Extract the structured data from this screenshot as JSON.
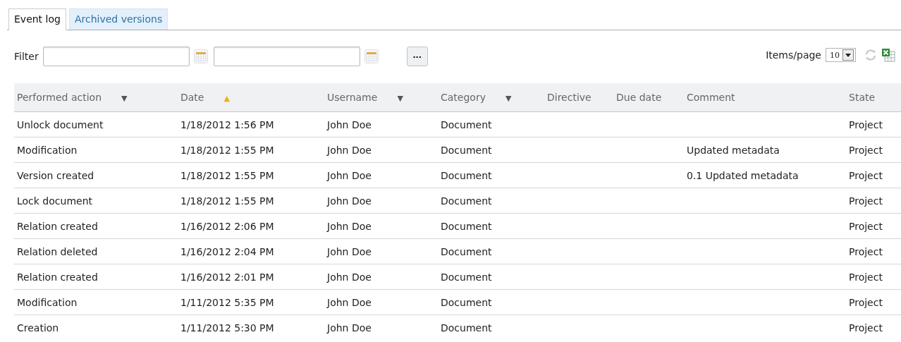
{
  "tabs": [
    {
      "label": "Event log",
      "selected": true
    },
    {
      "label": "Archived versions",
      "selected": false
    }
  ],
  "filter": {
    "label": "Filter",
    "more_button": "..."
  },
  "items_per_page": {
    "label": "Items/page",
    "value": "10"
  },
  "table": {
    "columns": [
      {
        "label": "Performed action",
        "indicator": "▼",
        "sorted": false
      },
      {
        "label": "Date",
        "indicator": "▲",
        "sorted": true
      },
      {
        "label": "Username",
        "indicator": "▼",
        "sorted": false
      },
      {
        "label": "Category",
        "indicator": "▼",
        "sorted": false
      },
      {
        "label": "Directive"
      },
      {
        "label": "Due date"
      },
      {
        "label": "Comment"
      },
      {
        "label": "State"
      }
    ],
    "rows": [
      [
        "Unlock document",
        "1/18/2012 1:56 PM",
        "John Doe",
        "Document",
        null,
        null,
        null,
        "Project"
      ],
      [
        "Modification",
        "1/18/2012 1:55 PM",
        "John Doe",
        "Document",
        null,
        null,
        "Updated metadata",
        "Project"
      ],
      [
        "Version created",
        "1/18/2012 1:55 PM",
        "John Doe",
        "Document",
        null,
        null,
        "0.1 Updated metadata",
        "Project"
      ],
      [
        "Lock document",
        "1/18/2012 1:55 PM",
        "John Doe",
        "Document",
        null,
        null,
        null,
        "Project"
      ],
      [
        "Relation created",
        "1/16/2012 2:06 PM",
        "John Doe",
        "Document",
        null,
        null,
        null,
        "Project"
      ],
      [
        "Relation deleted",
        "1/16/2012 2:04 PM",
        "John Doe",
        "Document",
        null,
        null,
        null,
        "Project"
      ],
      [
        "Relation created",
        "1/16/2012 2:01 PM",
        "John Doe",
        "Document",
        null,
        null,
        null,
        "Project"
      ],
      [
        "Modification",
        "1/11/2012 5:35 PM",
        "John Doe",
        "Document",
        null,
        null,
        null,
        "Project"
      ],
      [
        "Creation",
        "1/11/2012 5:30 PM",
        "John Doe",
        "Document",
        null,
        null,
        null,
        "Project"
      ]
    ]
  }
}
